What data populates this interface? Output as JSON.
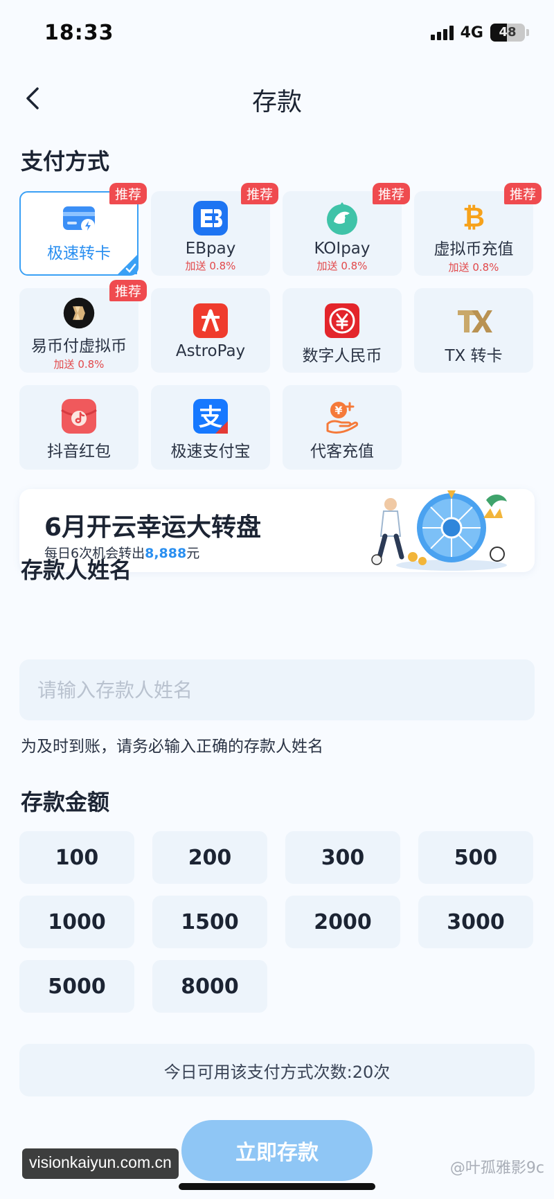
{
  "status": {
    "time": "18:33",
    "network": "4G",
    "battery": "48"
  },
  "header": {
    "title": "存款"
  },
  "payment": {
    "section_title": "支付方式",
    "methods": [
      {
        "name": "极速转卡",
        "badge": "推荐",
        "bonus": "",
        "icon": "bank-card-flash-icon"
      },
      {
        "name": "EBpay",
        "badge": "推荐",
        "bonus": "加送 0.8%",
        "icon": "ebpay-icon"
      },
      {
        "name": "KOIpay",
        "badge": "推荐",
        "bonus": "加送 0.8%",
        "icon": "koi-fish-icon"
      },
      {
        "name": "虚拟币充值",
        "badge": "推荐",
        "bonus": "加送 0.8%",
        "icon": "bitcoin-icon"
      },
      {
        "name": "易币付虚拟币",
        "badge": "推荐",
        "bonus": "加送 0.8%",
        "icon": "yibifu-icon"
      },
      {
        "name": "AstroPay",
        "badge": "",
        "bonus": "",
        "icon": "astropay-icon"
      },
      {
        "name": "数字人民币",
        "badge": "",
        "bonus": "",
        "icon": "digital-rmb-icon"
      },
      {
        "name": "TX 转卡",
        "badge": "",
        "bonus": "",
        "icon": "tx-icon"
      },
      {
        "name": "抖音红包",
        "badge": "",
        "bonus": "",
        "icon": "douyin-red-packet-icon"
      },
      {
        "name": "极速支付宝",
        "badge": "",
        "bonus": "",
        "icon": "alipay-icon"
      },
      {
        "name": "代客充值",
        "badge": "",
        "bonus": "",
        "icon": "agent-recharge-icon"
      }
    ],
    "selected_index": 0
  },
  "banner": {
    "title": "6月开云幸运大转盘",
    "subtitle_prefix": "每日6次机会转出",
    "amount": "8,888",
    "suffix": "元"
  },
  "name_section": {
    "title": "存款人姓名",
    "placeholder": "请输入存款人姓名",
    "value": "",
    "hint": "为及时到账，请务必输入正确的存款人姓名"
  },
  "amount_section": {
    "title": "存款金额",
    "options": [
      "100",
      "200",
      "300",
      "500",
      "1000",
      "1500",
      "2000",
      "3000",
      "5000",
      "8000"
    ]
  },
  "usage_text": "今日可用该支付方式次数:20次",
  "submit_label": "立即存款",
  "watermarks": {
    "left": "visionkaiyun.com.cn",
    "right": "@叶孤雅影9c"
  },
  "colors": {
    "accent": "#2a8ff0",
    "badge": "#ef4b4f",
    "bonus": "#e2484a",
    "card_bg": "#edf4fb"
  }
}
